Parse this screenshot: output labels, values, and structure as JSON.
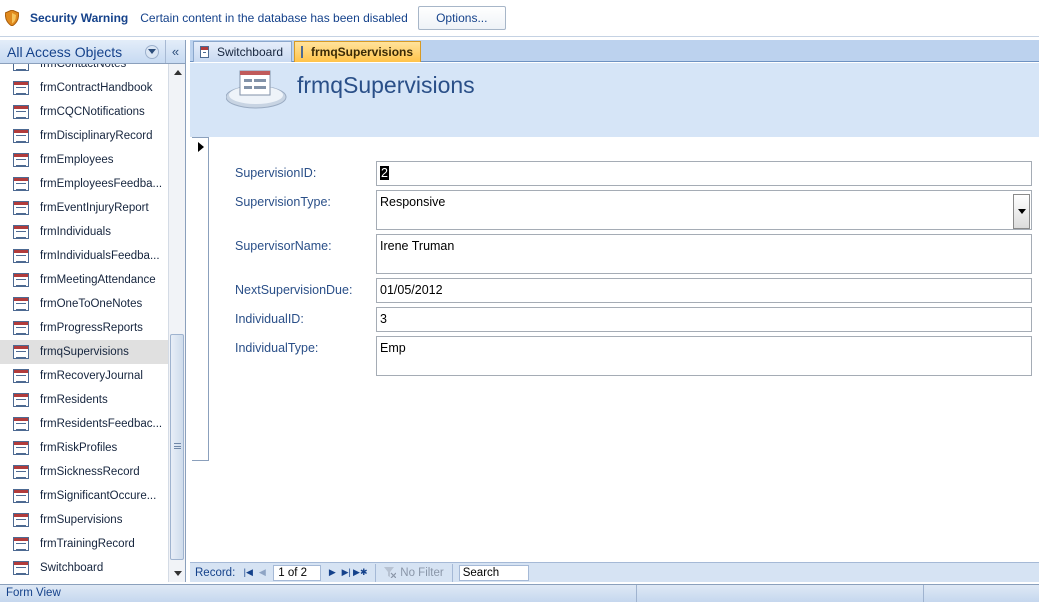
{
  "security_bar": {
    "title": "Security Warning",
    "message": "Certain content in the database has been disabled",
    "options_label": "Options..."
  },
  "nav_pane": {
    "title": "All Access Objects",
    "collapse_glyph": "«",
    "items": [
      {
        "label": "frmContactNotes"
      },
      {
        "label": "frmContractHandbook"
      },
      {
        "label": "frmCQCNotifications"
      },
      {
        "label": "frmDisciplinaryRecord"
      },
      {
        "label": "frmEmployees"
      },
      {
        "label": "frmEmployeesFeedba..."
      },
      {
        "label": "frmEventInjuryReport"
      },
      {
        "label": "frmIndividuals"
      },
      {
        "label": "frmIndividualsFeedba..."
      },
      {
        "label": "frmMeetingAttendance"
      },
      {
        "label": "frmOneToOneNotes"
      },
      {
        "label": "frmProgressReports"
      },
      {
        "label": "frmqSupervisions",
        "selected": true
      },
      {
        "label": "frmRecoveryJournal"
      },
      {
        "label": "frmResidents"
      },
      {
        "label": "frmResidentsFeedbac..."
      },
      {
        "label": "frmRiskProfiles"
      },
      {
        "label": "frmSicknessRecord"
      },
      {
        "label": "frmSignificantOccure..."
      },
      {
        "label": "frmSupervisions"
      },
      {
        "label": "frmTrainingRecord"
      },
      {
        "label": "Switchboard"
      }
    ]
  },
  "tabs": [
    {
      "label": "Switchboard",
      "active": false
    },
    {
      "label": "frmqSupervisions",
      "active": true
    }
  ],
  "form": {
    "title": "frmqSupervisions",
    "fields": [
      {
        "label": "SupervisionID:",
        "value": "2"
      },
      {
        "label": "SupervisionType:",
        "value": "Responsive"
      },
      {
        "label": "SupervisorName:",
        "value": "Irene Truman"
      },
      {
        "label": "NextSupervisionDue:",
        "value": "01/05/2012"
      },
      {
        "label": "IndividualID:",
        "value": "3"
      },
      {
        "label": "IndividualType:",
        "value": "Emp"
      }
    ]
  },
  "record_nav": {
    "label": "Record:",
    "position": "1 of 2",
    "filter_label": "No Filter",
    "search_label": "Search"
  },
  "status_bar": {
    "text": "Form View"
  },
  "colors": {
    "accent": "#15428b",
    "active_tab": "#ffc34a",
    "header_bg": "#d6e5f7"
  }
}
